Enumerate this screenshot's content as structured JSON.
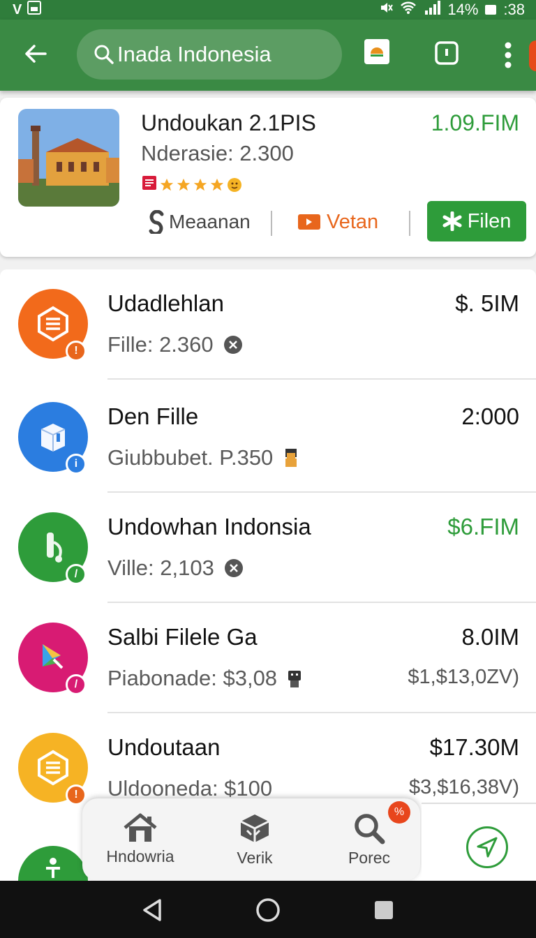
{
  "status_bar": {
    "left_glyphs": "V",
    "battery": "14%",
    "time": ":38"
  },
  "toolbar": {
    "search_text": "Inada Indonesia"
  },
  "featured": {
    "title": "Undoukan 2.1PIS",
    "subtitle": "Nderasie: 2.300",
    "price": "1.09.FIM",
    "rating_stars": 4,
    "actions": {
      "meaanan": "Meaanan",
      "vetan": "Vetan",
      "filen": "Filen"
    }
  },
  "list": [
    {
      "title": "Udadlehlan",
      "sub": "Fille: 2.360",
      "value": "$. 5IM",
      "value2": "",
      "icon_color": "#f26a1b",
      "badge_color": "#e8661c",
      "icon": "stack-icon",
      "green": false
    },
    {
      "title": "Den Fille",
      "sub": "Giubbubet. P.350",
      "value": "2:000",
      "value2": "",
      "icon_color": "#2b7de0",
      "badge_color": "#2b7de0",
      "icon": "box-icon",
      "green": false
    },
    {
      "title": "Undowhan Indonsia",
      "sub": "Ville: 2,103",
      "value": "$6.FIM",
      "value2": "",
      "icon_color": "#2e9c3a",
      "badge_color": "#2e9c3a",
      "icon": "music-note-icon",
      "green": true
    },
    {
      "title": "Salbi Filele Ga",
      "sub": "Piabonade: $3,08",
      "value": "8.0IM",
      "value2": "$1,$13,0ZV)",
      "icon_color": "#d81b73",
      "badge_color": "#d81b73",
      "icon": "play-icon",
      "green": false
    },
    {
      "title": "Undoutaan",
      "sub": "Uldooneda: $100",
      "value": "$17.30M",
      "value2": "$3,$16,38V)",
      "icon_color": "#f6b324",
      "badge_color": "#e8661c",
      "icon": "stack-icon",
      "green": false
    }
  ],
  "bottom_nav": [
    {
      "label": "Hndowria",
      "icon": "home-icon"
    },
    {
      "label": "Verik",
      "icon": "cube-icon"
    },
    {
      "label": "Porec",
      "icon": "search-icon"
    }
  ]
}
